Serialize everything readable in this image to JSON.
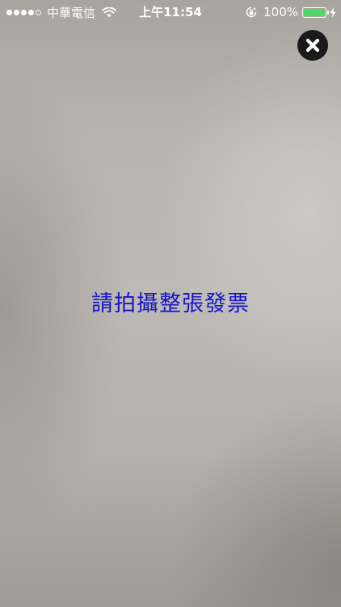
{
  "status_bar": {
    "signal_dots_filled": 4,
    "signal_dots_total": 5,
    "carrier": "中華電信",
    "time": "上午11:54",
    "battery_percent_label": "100%",
    "battery_level": 1.0,
    "icons": [
      "signal-icon",
      "wifi-icon",
      "rotation-lock-icon",
      "battery-icon",
      "charging-icon"
    ],
    "colors": {
      "battery": "#4cd964",
      "text": "#ffffff"
    }
  },
  "camera": {
    "close_icon": "close-icon",
    "instruction_text": "請拍攝整張發票",
    "colors": {
      "instruction": "#1515c8",
      "close_button": "#1a1a1a"
    }
  }
}
